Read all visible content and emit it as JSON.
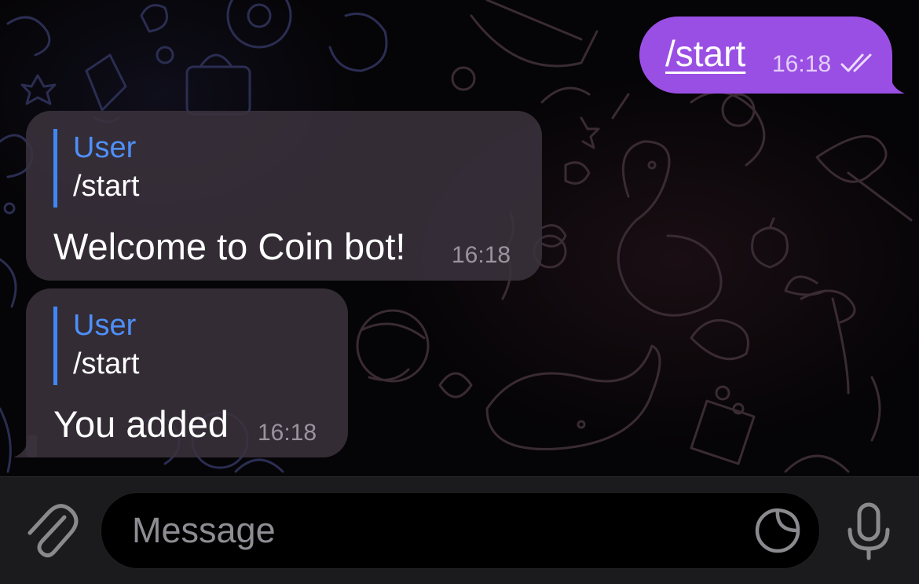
{
  "colors": {
    "outgoing_bubble": "#9a4fe4",
    "incoming_bubble": "#3a323c",
    "reply_accent": "#3f87f5",
    "background": "#000000",
    "input_bar": "#1b1b1d"
  },
  "messages": {
    "outgoing": {
      "text": "/start",
      "time": "16:18",
      "status_icon": "double-check-icon"
    },
    "incoming": [
      {
        "reply_name": "User",
        "reply_text": "/start",
        "text": "Welcome to Coin bot!",
        "time": "16:18"
      },
      {
        "reply_name": "User",
        "reply_text": "/start",
        "text": "You added",
        "time": "16:18"
      }
    ]
  },
  "input_bar": {
    "placeholder": "Message",
    "icons": [
      "attach-icon",
      "sticker-icon",
      "microphone-icon"
    ]
  }
}
